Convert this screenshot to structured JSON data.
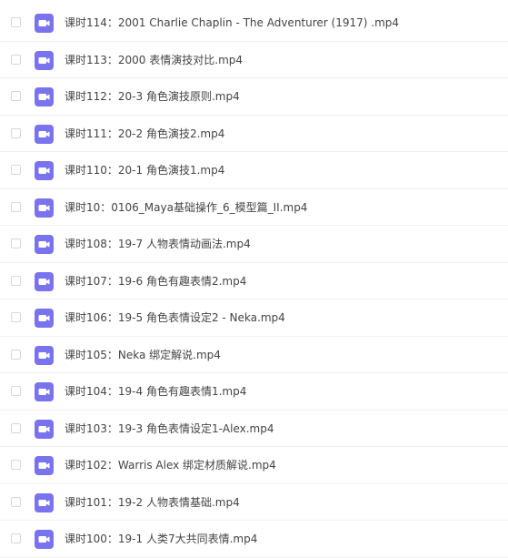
{
  "icon_color": "#7a73ee",
  "files": [
    {
      "name": "课时114：2001 Charlie Chaplin - The Adventurer (1917) .mp4"
    },
    {
      "name": "课时113：2000 表情演技对比.mp4"
    },
    {
      "name": "课时112：20-3 角色演技原则.mp4"
    },
    {
      "name": "课时111：20-2 角色演技2.mp4"
    },
    {
      "name": "课时110：20-1 角色演技1.mp4"
    },
    {
      "name": "课时10：0106_Maya基础操作_6_模型篇_II.mp4"
    },
    {
      "name": "课时108：19-7 人物表情动画法.mp4"
    },
    {
      "name": "课时107：19-6 角色有趣表情2.mp4"
    },
    {
      "name": "课时106：19-5 角色表情设定2 - Neka.mp4"
    },
    {
      "name": "课时105：Neka 绑定解说.mp4"
    },
    {
      "name": "课时104：19-4 角色有趣表情1.mp4"
    },
    {
      "name": "课时103：19-3 角色表情设定1-Alex.mp4"
    },
    {
      "name": "课时102：Warris Alex 绑定材质解说.mp4"
    },
    {
      "name": "课时101：19-2 人物表情基础.mp4"
    },
    {
      "name": "课时100：19-1 人类7大共同表情.mp4"
    }
  ]
}
